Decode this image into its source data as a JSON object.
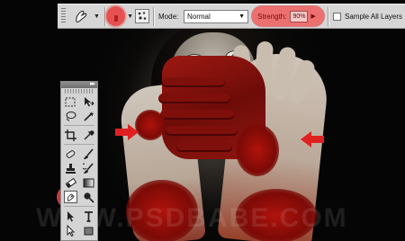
{
  "options_bar": {
    "tool_preset_icon": "smudge-finger-icon",
    "brush_size_icon": "brush-size-icon",
    "brush_panel_icon": "brush-panel-icon",
    "mode_label": "Mode:",
    "mode_value": "Normal",
    "strength_label": "Strength:",
    "strength_value": "90%",
    "sample_all_layers_label": "Sample All Layers",
    "sample_all_layers_checked": false,
    "highlight_color": "#e55050"
  },
  "tools_panel": {
    "collapse_icon": "double-chevron-icon",
    "rows": [
      [
        "rectangular-marquee-icon",
        "move-icon"
      ],
      [
        "lasso-icon",
        "magic-wand-icon"
      ],
      [
        "crop-icon",
        "eyedropper-icon"
      ],
      [
        "spot-healing-icon",
        "brush-icon"
      ],
      [
        "clone-stamp-icon",
        "history-brush-icon"
      ],
      [
        "eraser-icon",
        "gradient-icon"
      ],
      [
        "smudge-icon",
        "dodge-icon"
      ],
      [
        "path-selection-icon",
        "type-icon"
      ],
      [
        "direct-select-icon",
        "rectangle-shape-icon"
      ]
    ],
    "active_tool": "smudge-icon"
  },
  "annotations": {
    "arrow_color": "#e02020",
    "arrows": [
      "arrow-left-hand",
      "arrow-right-hand"
    ]
  },
  "watermark": {
    "text": "WWW.PSDBABE.COM"
  }
}
